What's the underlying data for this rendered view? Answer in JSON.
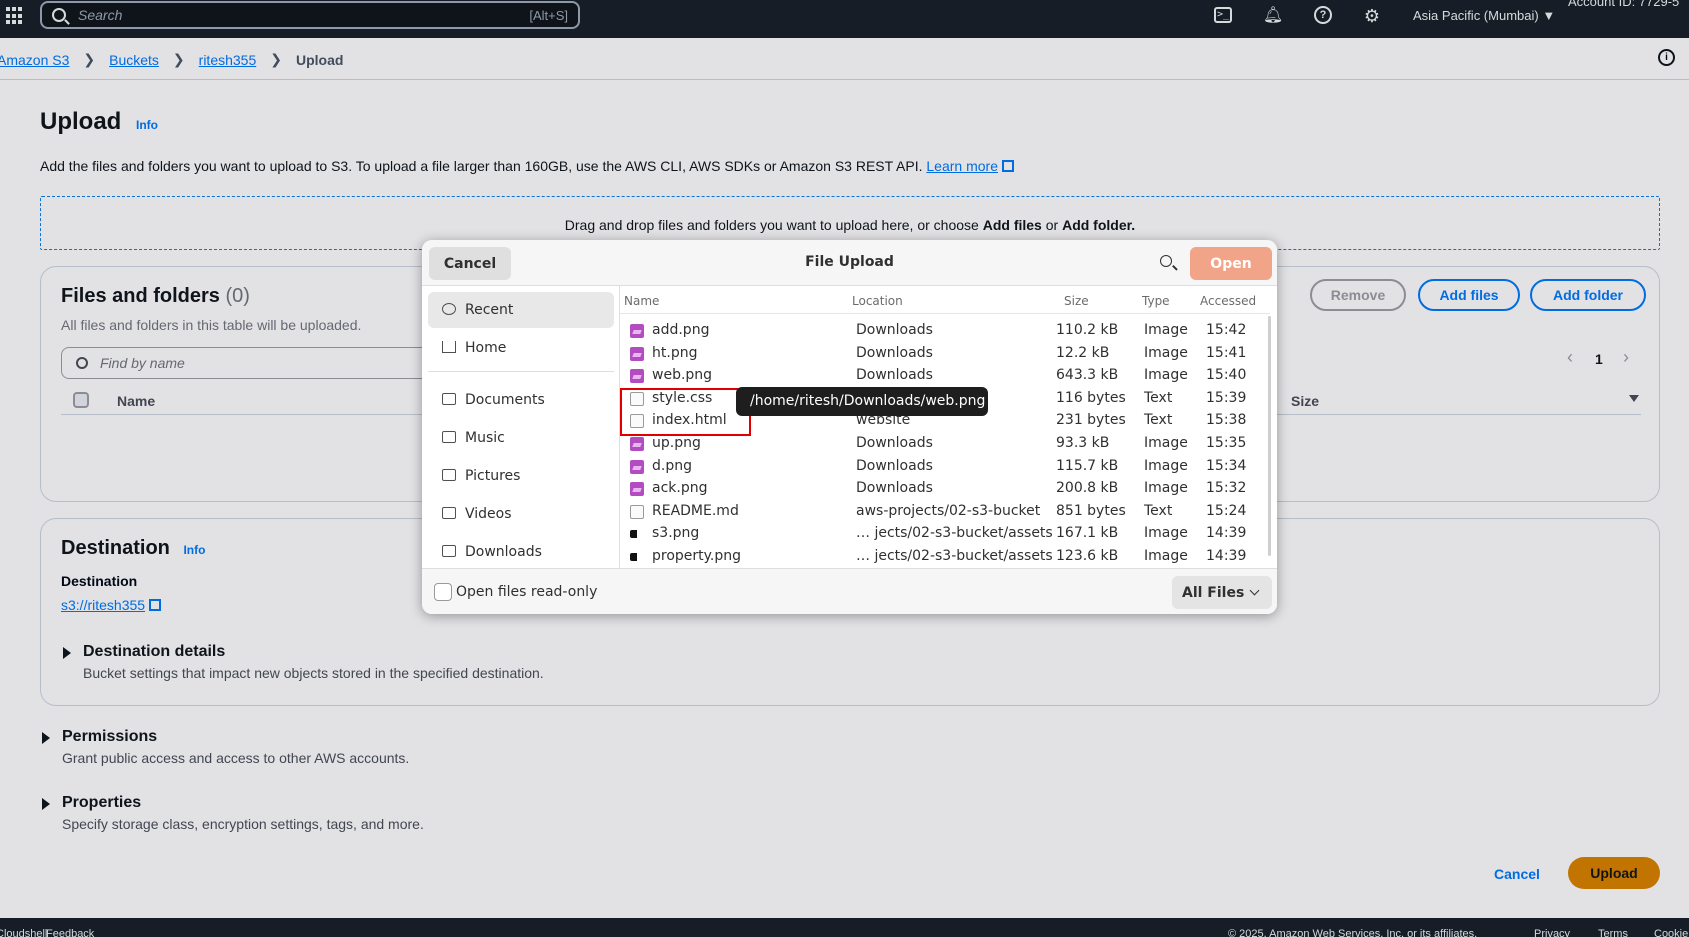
{
  "topnav": {
    "search_placeholder": "Search",
    "search_shortcut": "[Alt+S]",
    "region": "Asia Pacific (Mumbai)",
    "account": "Account ID: 7729-5"
  },
  "breadcrumb": {
    "items": [
      "Amazon S3",
      "Buckets",
      "ritesh355"
    ],
    "current": "Upload"
  },
  "page": {
    "title": "Upload",
    "info": "Info",
    "description": "Add the files and folders you want to upload to S3. To upload a file larger than 160GB, use the AWS CLI, AWS SDKs or Amazon S3 REST API.",
    "learn_more": "Learn more",
    "dropzone_prefix": "Drag and drop files and folders you want to upload here, or choose",
    "dropzone_add_files": "Add files",
    "dropzone_or": "or",
    "dropzone_add_folder": "Add folder."
  },
  "files_panel": {
    "title": "Files and folders",
    "count": "(0)",
    "subtitle": "All files and folders in this table will be uploaded.",
    "find_placeholder": "Find by name",
    "remove": "Remove",
    "add_files": "Add files",
    "add_folder": "Add folder",
    "page": "1",
    "col_name": "Name",
    "col_size": "Size"
  },
  "destination": {
    "title": "Destination",
    "info": "Info",
    "label": "Destination",
    "link": "s3://ritesh355",
    "details_title": "Destination details",
    "details_desc": "Bucket settings that impact new objects stored in the specified destination."
  },
  "permissions": {
    "title": "Permissions",
    "desc": "Grant public access and access to other AWS accounts."
  },
  "properties": {
    "title": "Properties",
    "desc": "Specify storage class, encryption settings, tags, and more."
  },
  "actions": {
    "cancel": "Cancel",
    "upload": "Upload"
  },
  "footer": {
    "left1": "Cloudshell",
    "left2": "Feedback",
    "copyright": "© 2025, Amazon Web Services, Inc. or its affiliates.",
    "privacy": "Privacy",
    "terms": "Terms",
    "cookie": "Cookie preferences"
  },
  "dialog": {
    "cancel": "Cancel",
    "title": "File Upload",
    "open": "Open",
    "places": [
      "Recent",
      "Home",
      "Documents",
      "Music",
      "Pictures",
      "Videos",
      "Downloads"
    ],
    "columns": [
      "Name",
      "Location",
      "Size",
      "Type",
      "Accessed"
    ],
    "files": [
      {
        "name": "add.png",
        "location": "Downloads",
        "size": "110.2 kB",
        "type": "Image",
        "accessed": "15:42",
        "icon": "image-file-icon"
      },
      {
        "name": "ht.png",
        "location": "Downloads",
        "size": "12.2 kB",
        "type": "Image",
        "accessed": "15:41",
        "icon": "image-file-icon"
      },
      {
        "name": "web.png",
        "location": "Downloads",
        "size": "643.3 kB",
        "type": "Image",
        "accessed": "15:40",
        "icon": "image-file-icon"
      },
      {
        "name": "style.css",
        "location": "website",
        "size": "116 bytes",
        "type": "Text",
        "accessed": "15:39",
        "icon": "css-file-icon"
      },
      {
        "name": "index.html",
        "location": "website",
        "size": "231 bytes",
        "type": "Text",
        "accessed": "15:38",
        "icon": "html-file-icon"
      },
      {
        "name": "up.png",
        "location": "Downloads",
        "size": "93.3 kB",
        "type": "Image",
        "accessed": "15:35",
        "icon": "image-file-icon"
      },
      {
        "name": "d.png",
        "location": "Downloads",
        "size": "115.7 kB",
        "type": "Image",
        "accessed": "15:34",
        "icon": "image-file-icon"
      },
      {
        "name": "ack.png",
        "location": "Downloads",
        "size": "200.8 kB",
        "type": "Image",
        "accessed": "15:32",
        "icon": "image-file-icon"
      },
      {
        "name": "README.md",
        "location": "aws-projects/02-s3-bucket",
        "size": "851 bytes",
        "type": "Text",
        "accessed": "15:24",
        "icon": "markdown-file-icon"
      },
      {
        "name": "s3.png",
        "location": "… jects/02-s3-bucket/assets",
        "size": "167.1 kB",
        "type": "Image",
        "accessed": "14:39",
        "icon": "image-thumb-icon"
      },
      {
        "name": "property.png",
        "location": "… jects/02-s3-bucket/assets",
        "size": "123.6 kB",
        "type": "Image",
        "accessed": "14:39",
        "icon": "image-thumb-icon"
      }
    ],
    "readonly_label": "Open files read-only",
    "filter": "All Files",
    "tooltip": "/home/ritesh/Downloads/web.png"
  }
}
